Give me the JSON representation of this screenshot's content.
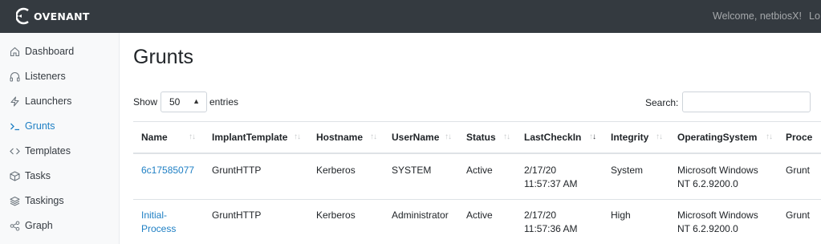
{
  "navbar": {
    "brand": "OVENANT",
    "welcome": "Welcome, netbiosX!",
    "logout": "Lo"
  },
  "sidebar": {
    "items": [
      {
        "label": "Dashboard",
        "icon": "home-icon"
      },
      {
        "label": "Listeners",
        "icon": "headphones-icon"
      },
      {
        "label": "Launchers",
        "icon": "zap-icon"
      },
      {
        "label": "Grunts",
        "icon": "terminal-icon",
        "active": true
      },
      {
        "label": "Templates",
        "icon": "code-icon"
      },
      {
        "label": "Tasks",
        "icon": "box-icon"
      },
      {
        "label": "Taskings",
        "icon": "layers-icon"
      },
      {
        "label": "Graph",
        "icon": "share-icon"
      }
    ]
  },
  "page": {
    "title": "Grunts",
    "show_label": "Show",
    "entries_value": "50",
    "entries_label": "entries",
    "search_label": "Search:",
    "search_value": ""
  },
  "table": {
    "columns": [
      "Name",
      "ImplantTemplate",
      "Hostname",
      "UserName",
      "Status",
      "LastCheckIn",
      "Integrity",
      "OperatingSystem",
      "Proce"
    ],
    "sorted_column": "LastCheckIn",
    "rows": [
      {
        "name": [
          "6c17585077"
        ],
        "implant_template": "GruntHTTP",
        "hostname": "Kerberos",
        "username": "SYSTEM",
        "status": "Active",
        "last_check_in": [
          "2/17/20",
          "11:57:37 AM"
        ],
        "integrity": "System",
        "operating_system": [
          "Microsoft Windows",
          "NT 6.2.9200.0"
        ],
        "process": "Grunt"
      },
      {
        "name": [
          "Initial-",
          "Process"
        ],
        "implant_template": "GruntHTTP",
        "hostname": "Kerberos",
        "username": "Administrator",
        "status": "Active",
        "last_check_in": [
          "2/17/20",
          "11:57:36 AM"
        ],
        "integrity": "High",
        "operating_system": [
          "Microsoft Windows",
          "NT 6.2.9200.0"
        ],
        "process": "Grunt"
      }
    ]
  },
  "colors": {
    "navbar_bg": "#343a40",
    "sidebar_bg": "#f8f9fa",
    "link": "#1e7fc4"
  }
}
